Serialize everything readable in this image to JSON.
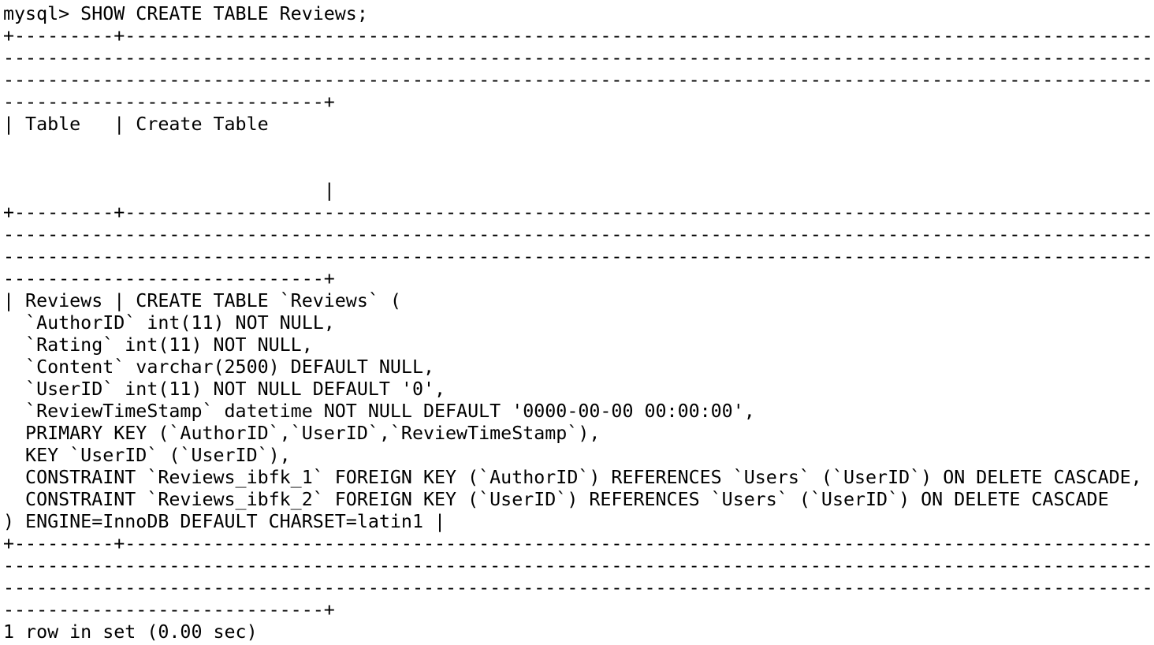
{
  "terminal": {
    "lines": [
      "mysql> SHOW CREATE TABLE Reviews;",
      "+---------+----------------------------------------------------------------------------------------------------",
      "---------------------------------------------------------------------------------------------------------------",
      "---------------------------------------------------------------------------------------------------------------",
      "-----------------------------+",
      "| Table   | Create Table",
      "",
      "",
      "                             |",
      "+---------+----------------------------------------------------------------------------------------------------",
      "---------------------------------------------------------------------------------------------------------------",
      "---------------------------------------------------------------------------------------------------------------",
      "-----------------------------+",
      "| Reviews | CREATE TABLE `Reviews` (",
      "  `AuthorID` int(11) NOT NULL,",
      "  `Rating` int(11) NOT NULL,",
      "  `Content` varchar(2500) DEFAULT NULL,",
      "  `UserID` int(11) NOT NULL DEFAULT '0',",
      "  `ReviewTimeStamp` datetime NOT NULL DEFAULT '0000-00-00 00:00:00',",
      "  PRIMARY KEY (`AuthorID`,`UserID`,`ReviewTimeStamp`),",
      "  KEY `UserID` (`UserID`),",
      "  CONSTRAINT `Reviews_ibfk_1` FOREIGN KEY (`AuthorID`) REFERENCES `Users` (`UserID`) ON DELETE CASCADE,",
      "  CONSTRAINT `Reviews_ibfk_2` FOREIGN KEY (`UserID`) REFERENCES `Users` (`UserID`) ON DELETE CASCADE",
      ") ENGINE=InnoDB DEFAULT CHARSET=latin1 |",
      "+---------+----------------------------------------------------------------------------------------------------",
      "---------------------------------------------------------------------------------------------------------------",
      "---------------------------------------------------------------------------------------------------------------",
      "-----------------------------+",
      "1 row in set (0.00 sec)"
    ]
  }
}
